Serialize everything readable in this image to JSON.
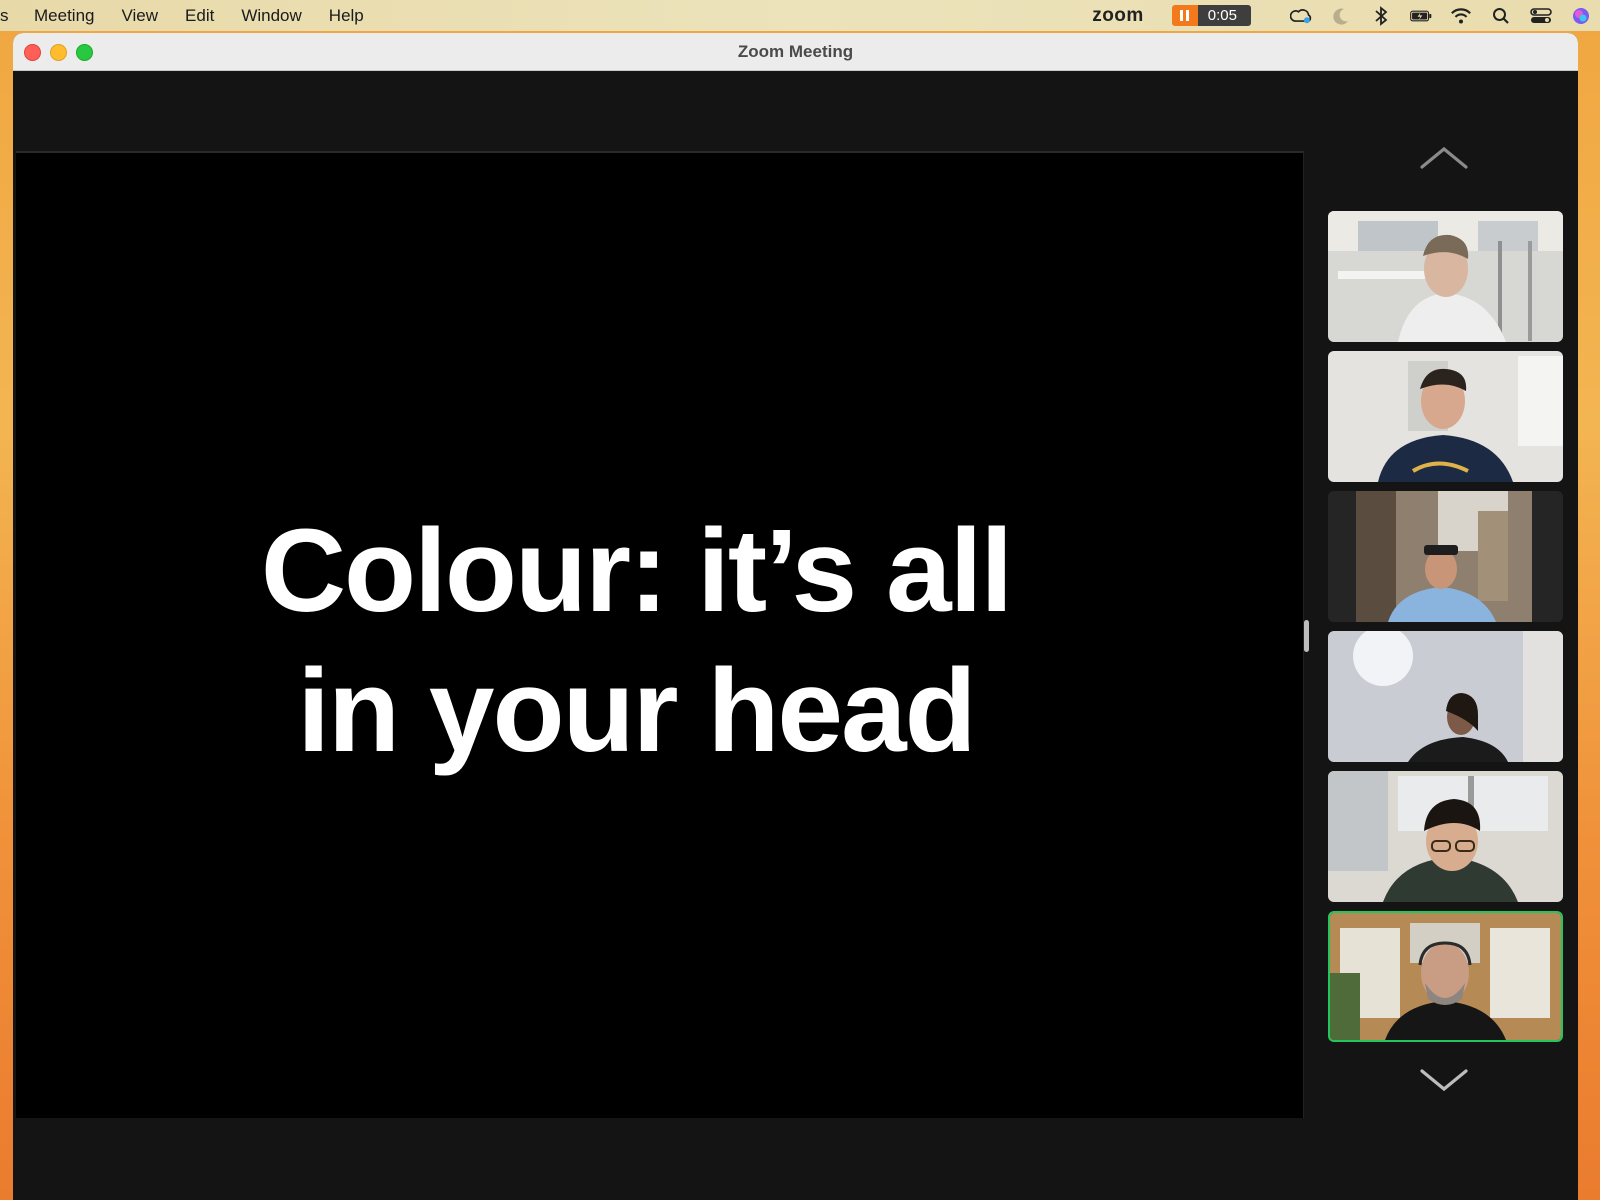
{
  "menubar": {
    "app_cut": "s",
    "menus": [
      "Meeting",
      "View",
      "Edit",
      "Window",
      "Help"
    ],
    "status": {
      "app_word": "zoom",
      "recording_time": "0:05"
    }
  },
  "window": {
    "title": "Zoom Meeting"
  },
  "share": {
    "slide_title_line1": "Colour: it’s all",
    "slide_title_line2": "in your head"
  },
  "gallery": {
    "tiles": [
      {
        "id": "participant-1",
        "active": false
      },
      {
        "id": "participant-2",
        "active": false
      },
      {
        "id": "participant-3",
        "active": false
      },
      {
        "id": "participant-4",
        "active": false
      },
      {
        "id": "participant-5",
        "active": false
      },
      {
        "id": "participant-6",
        "active": true
      }
    ],
    "active_border_color": "#22c55e"
  },
  "icons": [
    "pause-icon",
    "creative-cloud-icon",
    "moon-icon",
    "bluetooth-icon",
    "battery-icon",
    "wifi-icon",
    "search-icon",
    "control-center-icon",
    "siri-icon",
    "chevron-up-icon",
    "chevron-down-icon"
  ]
}
